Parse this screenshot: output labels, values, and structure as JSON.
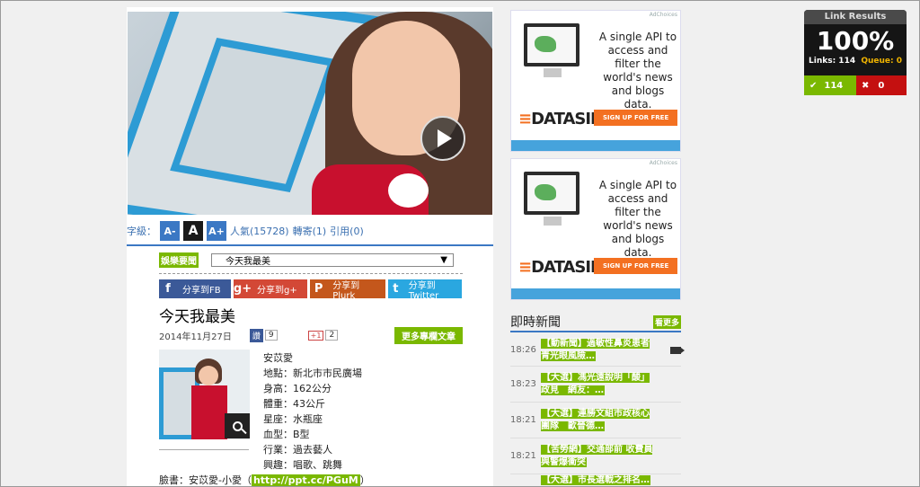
{
  "font_bar": {
    "label": "字級：",
    "smaller": "A-",
    "normal": "A",
    "larger": "A+",
    "popularity": "人氣(15728)",
    "reposts": "轉寄(1)",
    "citations": "引用(0)"
  },
  "category": {
    "tag": "娛樂要聞",
    "selected": "今天我最美",
    "arrow": "▼"
  },
  "share": {
    "fb": "分享到FB",
    "gplus": "分享到g+",
    "plurk": "分享到Plurk",
    "twitter": "分享到Twitter",
    "fb_icon": "f",
    "gplus_icon": "g+",
    "plurk_icon": "P",
    "twitter_icon": "t"
  },
  "article": {
    "title": "今天我最美",
    "date": "2014年11月27日",
    "like_label": "讚",
    "like_count": "9",
    "gplus_label": "+1",
    "gplus_count": "2",
    "more_button": "更多專欄文章",
    "info": [
      "安苡愛",
      "地點：新北市市民廣場",
      "身高：162公分",
      "體重：43公斤",
      "星座：水瓶座",
      "血型：B型",
      "行業：過去藝人",
      "興趣：唱歌、跳舞"
    ],
    "facebook_label": "臉書：安苡愛-小愛（",
    "facebook_link": "http://ppt.cc/PGuM",
    "facebook_end": "）"
  },
  "ads": [
    {
      "choices": "AdChoices",
      "text": "A single API to access and filter the world's news and blogs data.",
      "logo_accent": "≡",
      "logo": "DATASIFT",
      "cta": "SIGN UP FOR FREE"
    },
    {
      "choices": "AdChoices",
      "text": "A single API to access and filter the world's news and blogs data.",
      "logo_accent": "≡",
      "logo": "DATASIFT",
      "cta": "SIGN UP FOR FREE"
    }
  ],
  "news": {
    "heading": "即時新聞",
    "more": "看更多",
    "items": [
      {
        "time": "18:26",
        "text": "【動新聞】過敏性鼻炎患者青光眼風險…"
      },
      {
        "time": "18:23",
        "text": "【大選】馮光遠說明「酸」政見　網友：…"
      },
      {
        "time": "18:21",
        "text": "【大選】連勝文組市政核心團隊　歐晉德…"
      },
      {
        "time": "18:21",
        "text": "【苦勞網】交通部前 收費員與警爆衝突"
      },
      {
        "time": "",
        "text": "【大選】市長選戰之排名…"
      }
    ]
  },
  "link_results": {
    "header": "Link Results",
    "percent": "100%",
    "links_label": "Links: 114",
    "queue_label": "Queue: 0",
    "ok_icon": "✔",
    "ok_count": "114",
    "bad_icon": "✖",
    "bad_count": "0"
  },
  "colors": {
    "accent_blue": "#3b78c4",
    "tag_green": "#7ab800",
    "datasift_orange": "#f37021"
  }
}
